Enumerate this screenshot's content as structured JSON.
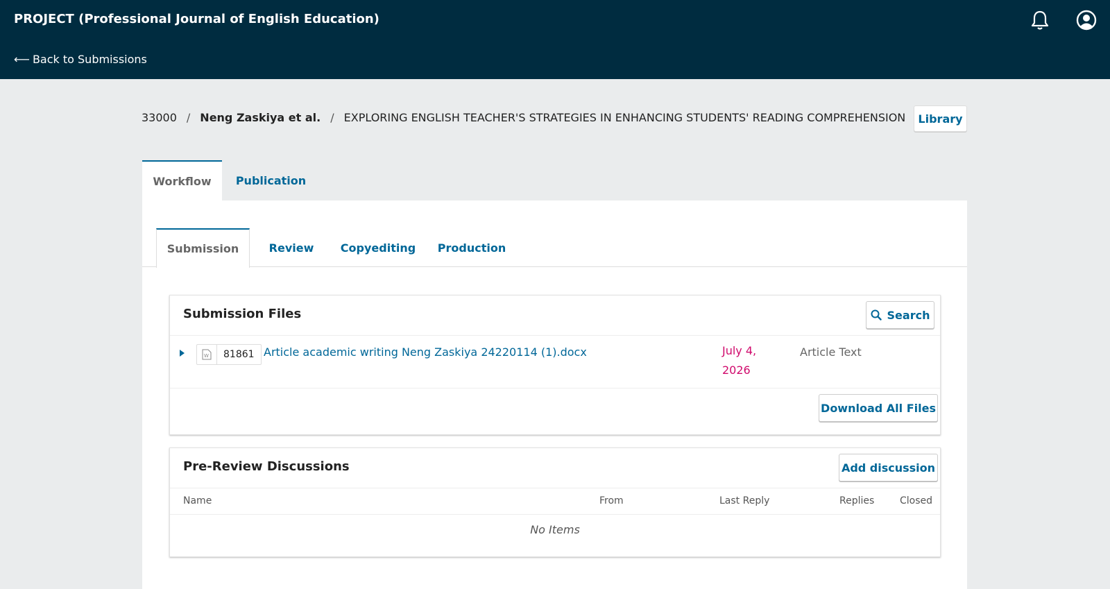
{
  "header": {
    "site_title": "PROJECT (Professional Journal of English Education)",
    "back_arrow": "⟵",
    "back_label": "Back to Submissions"
  },
  "breadcrumb": {
    "id": "33000",
    "author": "Neng Zaskiya et al.",
    "title": "EXPLORING ENGLISH TEACHER'S STRATEGIES IN ENHANCING STUDENTS' READING COMPREHENSION",
    "separator": "/"
  },
  "library_label": "Library",
  "main_tabs": [
    "Workflow",
    "Publication"
  ],
  "stage_tabs": [
    "Submission",
    "Review",
    "Copyediting",
    "Production"
  ],
  "submission_files": {
    "title": "Submission Files",
    "search_label": "Search",
    "files": [
      {
        "id": "81861",
        "name": "Article academic writing Neng Zaskiya 24220114 (1).docx",
        "date": "July 4, 2026",
        "type": "Article Text"
      }
    ],
    "download_all_label": "Download All Files"
  },
  "discussions": {
    "title": "Pre-Review Discussions",
    "add_label": "Add discussion",
    "columns": [
      "Name",
      "From",
      "Last Reply",
      "Replies",
      "Closed"
    ],
    "empty_text": "No Items"
  },
  "colors": {
    "header_bg": "#002c40",
    "accent": "#006798",
    "date": "#d00a6c",
    "page_bg": "#eaeced"
  }
}
